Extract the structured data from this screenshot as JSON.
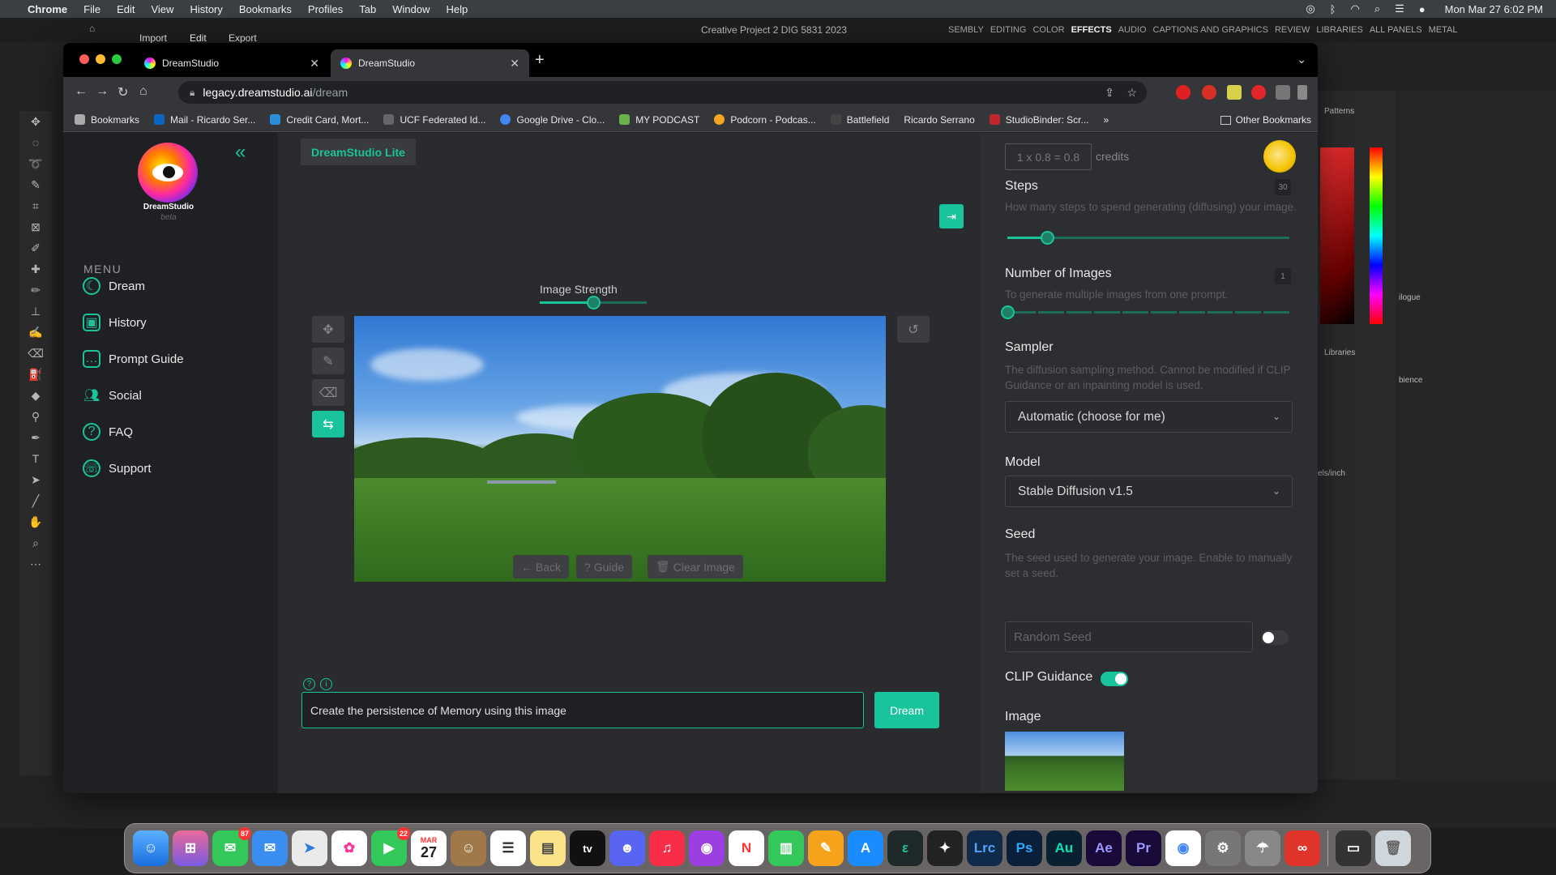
{
  "menubar": {
    "app": "Chrome",
    "items": [
      "File",
      "Edit",
      "View",
      "History",
      "Bookmarks",
      "Profiles",
      "Tab",
      "Window",
      "Help"
    ],
    "clock": "Mon Mar 27  6:02 PM"
  },
  "premiere": {
    "tabs": [
      "Import",
      "Edit",
      "Export"
    ],
    "project": "Creative Project 2 DIG 5831 2023",
    "workspaces": [
      "SEMBLY",
      "EDITING",
      "COLOR",
      "EFFECTS",
      "AUDIO",
      "CAPTIONS AND GRAPHICS",
      "REVIEW",
      "LIBRARIES",
      "ALL PANELS",
      "METAL"
    ],
    "active_workspace": "EFFECTS",
    "panel_labels": {
      "patterns": "Patterns",
      "libraries": "Libraries",
      "catalogue": "ilogue",
      "units": "els/inch",
      "audience": "bience"
    }
  },
  "browser": {
    "tabs": [
      {
        "title": "DreamStudio"
      },
      {
        "title": "DreamStudio"
      }
    ],
    "url_host": "legacy.dreamstudio.ai",
    "url_path": "/dream",
    "bookmarks": [
      "Bookmarks",
      "Mail - Ricardo Ser...",
      "Credit Card, Mort...",
      "UCF Federated Id...",
      "Google Drive - Clo...",
      "MY PODCAST",
      "Podcorn - Podcas...",
      "Battlefield",
      "Ricardo Serrano",
      "StudioBinder: Scr..."
    ],
    "other_bookmarks": "Other Bookmarks",
    "more": "»"
  },
  "app": {
    "brand": "DreamStudio",
    "brand_sub": "beta",
    "badge": "DreamStudio Lite",
    "menu_heading": "MENU",
    "menu": [
      {
        "label": "Dream"
      },
      {
        "label": "History"
      },
      {
        "label": "Prompt Guide"
      },
      {
        "label": "Social"
      },
      {
        "label": "FAQ"
      },
      {
        "label": "Support"
      }
    ],
    "image_strength_label": "Image Strength",
    "image_strength_value": 0.5,
    "actions": {
      "back": "Back",
      "guide": "Guide",
      "clear": "Clear Image"
    },
    "prompt_text": "Create the persistence of Memory using this image",
    "dream_button": "Dream",
    "credits_value": "1 x 0.8 = 0.8",
    "credits_label": "credits"
  },
  "settings": {
    "steps": {
      "label": "Steps",
      "value": "30",
      "desc": "How many steps to spend generating (diffusing) your image.",
      "fraction": 0.14
    },
    "num_images": {
      "label": "Number of Images",
      "value": "1",
      "desc": "To generate multiple images from one prompt.",
      "fraction": 0.0
    },
    "sampler": {
      "label": "Sampler",
      "desc": "The diffusion sampling method. Cannot be modified if CLIP Guidance or an inpainting model is used.",
      "selected": "Automatic (choose for me)"
    },
    "model": {
      "label": "Model",
      "selected": "Stable Diffusion v1.5"
    },
    "seed": {
      "label": "Seed",
      "desc": "The seed used to generate your image. Enable to manually set a seed.",
      "placeholder": "Random Seed",
      "enabled": false
    },
    "clip": {
      "label": "CLIP Guidance",
      "enabled": true
    },
    "image": {
      "label": "Image"
    }
  },
  "dock": {
    "badges": {
      "messages": "87",
      "facetime": "22"
    },
    "calendar_month": "MAR",
    "calendar_day": "27",
    "labels": {
      "tv": "tv",
      "lrc": "Lrc",
      "ps": "Ps",
      "au": "Au",
      "ae": "Ae",
      "pr": "Pr"
    }
  },
  "colors": {
    "accent": "#19c39c",
    "sidebar": "#1f2023",
    "panel": "#2d2e31"
  }
}
